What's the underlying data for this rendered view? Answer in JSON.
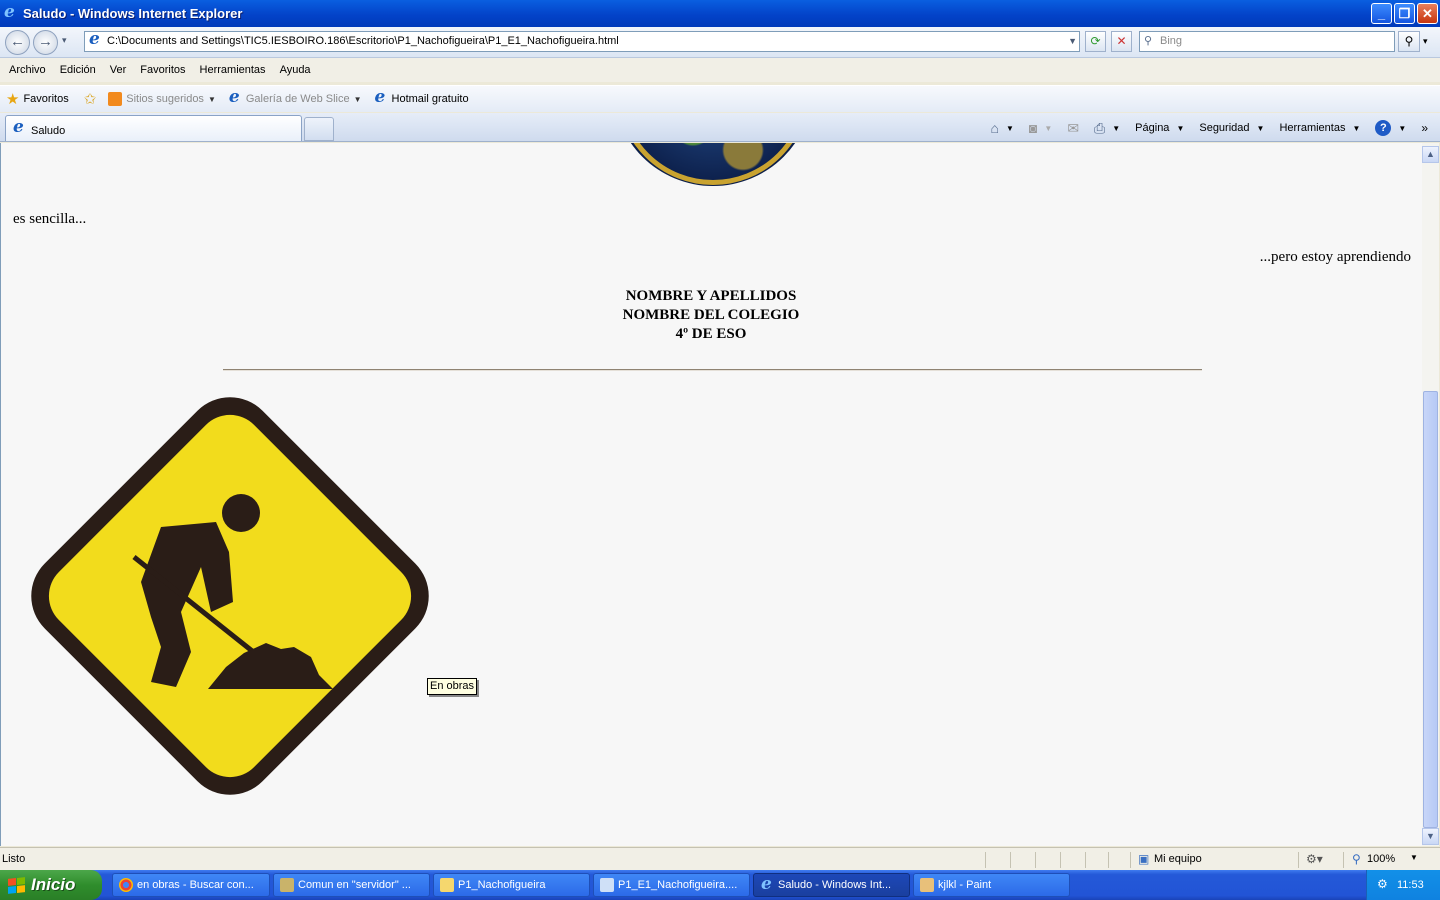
{
  "window": {
    "title": "Saludo - Windows Internet Explorer",
    "controls": [
      "minimize-icon",
      "restore-icon",
      "close-icon"
    ]
  },
  "address": {
    "url": "C:\\Documents and Settings\\TIC5.IESBOIRO.186\\Escritorio\\P1_Nachofigueira\\P1_E1_Nachofigueira.html",
    "search_placeholder": "Bing"
  },
  "menu": [
    "Archivo",
    "Edición",
    "Ver",
    "Favoritos",
    "Herramientas",
    "Ayuda"
  ],
  "favorites_bar": {
    "favorites_label": "Favoritos",
    "items": [
      "Sitios sugeridos",
      "Galería de Web Slice",
      "Hotmail gratuito"
    ]
  },
  "tabs": [
    {
      "label": "Saludo"
    }
  ],
  "commandbar": [
    "Página",
    "Seguridad",
    "Herramientas"
  ],
  "page": {
    "left_text": "es sencilla...",
    "right_text": "...pero estoy aprendiendo",
    "center_lines": [
      "NOMBRE Y APELLIDOS",
      "NOMBRE DEL COLEGIO",
      "4º DE ESO"
    ],
    "tooltip": "En obras",
    "colors": {
      "sign_yellow": "#f2dc1c",
      "sign_border": "#2a1d17",
      "background": "#f7f7f7"
    }
  },
  "status": {
    "text": "Listo",
    "zone": "Mi equipo",
    "zoom": "100%"
  },
  "taskbar": {
    "start_label": "Inicio",
    "items": [
      {
        "label": "en obras - Buscar con..."
      },
      {
        "label": "Comun en \"servidor\" ..."
      },
      {
        "label": "P1_Nachofigueira"
      },
      {
        "label": "P1_E1_Nachofigueira...."
      },
      {
        "label": "Saludo - Windows Int..."
      },
      {
        "label": "kjlkl - Paint"
      }
    ],
    "active_index": 4,
    "clock": "11:53"
  }
}
